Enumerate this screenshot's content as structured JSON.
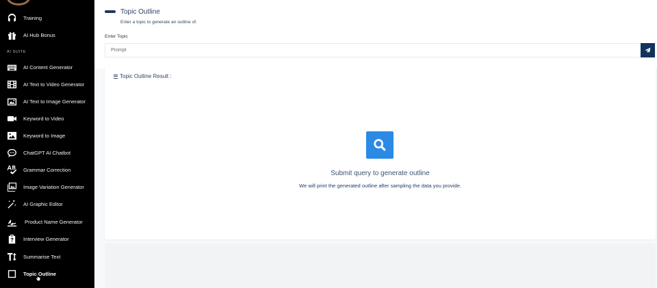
{
  "sidebar": {
    "section_label": "AI SUITE",
    "items": [
      {
        "label": "Training",
        "icon": "headset-icon"
      },
      {
        "label": "AI Hub Bonus",
        "icon": "gift-icon"
      },
      {
        "label": "AI Content Generator",
        "icon": "keyboard-icon"
      },
      {
        "label": "AI Text to Video Generator",
        "icon": "film-icon"
      },
      {
        "label": "AI Text to Image Generator",
        "icon": "image-icon"
      },
      {
        "label": "Keyword to Video",
        "icon": "video-camera-icon"
      },
      {
        "label": "Keyword to Image",
        "icon": "picture-icon"
      },
      {
        "label": "ChatGPT AI Chatbot",
        "icon": "chat-bubble-icon"
      },
      {
        "label": "Grammar Correction",
        "icon": "spellcheck-icon"
      },
      {
        "label": "Image Variation Generator",
        "icon": "images-icon"
      },
      {
        "label": "AI Graphic Editor",
        "icon": "magic-wand-icon"
      },
      {
        "label": "Product Name Generator",
        "icon": "signature-icon"
      },
      {
        "label": "Interview Generator",
        "icon": "clipboard-question-icon"
      },
      {
        "label": "Summarise Text",
        "icon": "text-height-icon"
      },
      {
        "label": "Topic Outline",
        "icon": "square-outline-icon",
        "active": true
      }
    ]
  },
  "header": {
    "title": "Topic Outline",
    "subtitle": "Enter a topic to generate an outline of."
  },
  "form": {
    "label": "Enter Topic",
    "placeholder": "Prompt",
    "value": "",
    "send_icon": "paper-plane-icon"
  },
  "result": {
    "title": "Topic Outline Result :",
    "title_icon": "list-icon",
    "empty_icon": "search-icon",
    "empty_heading": "Submit query to generate outline",
    "empty_text": "We will print the generated outline after sampling the data you provide."
  },
  "colors": {
    "sidebar_bg": "#000000",
    "accent_dark": "#12325e",
    "accent_blue": "#2b8ae6",
    "title_text": "#2e4563"
  }
}
